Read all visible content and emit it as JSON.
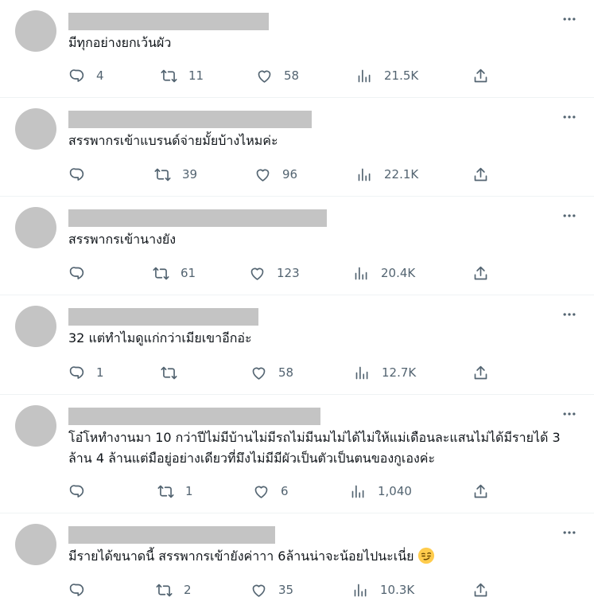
{
  "tweets": [
    {
      "text": "มีทุกอย่างยกเว้นผัว",
      "replies": "4",
      "retweets": "11",
      "likes": "58",
      "views": "21.5K"
    },
    {
      "text": "สรรพากรเข้าแบรนด์จ่ายมั้ยบ้างไหมค่ะ",
      "replies": "",
      "retweets": "39",
      "likes": "96",
      "views": "22.1K"
    },
    {
      "text": "สรรพากรเข้านางยัง",
      "replies": "",
      "retweets": "61",
      "likes": "123",
      "views": "20.4K"
    },
    {
      "text": "32 แต่ทำไมดูแก่กว่าเมียเขาอีกอ่ะ",
      "replies": "1",
      "retweets": "",
      "likes": "58",
      "views": "12.7K"
    },
    {
      "text": "โอ๋โหทำงานมา 10 กว่าปีไม่มีบ้านไม่มีรถไม่มีนมไม่ได้ไม่ให้แม่เดือนละแสนไม่ได้มีรายได้ 3 ล้าน 4 ล้านแต่มือยู่อย่างเดียวที่มึงไม่มีมีผัวเป็นตัวเป็นตนของกูเองค่ะ",
      "replies": "",
      "retweets": "1",
      "likes": "6",
      "views": "1,040"
    },
    {
      "text": "มีรายได้ขนาดนี้ สรรพากรเข้ายังค่าาา 6ล้านน่าจะน้อยไปนะเนี่ย",
      "emoji": "smirking-face",
      "replies": "",
      "retweets": "2",
      "likes": "35",
      "views": "10.3K"
    }
  ],
  "icons": {
    "reply": "reply-icon",
    "retweet": "retweet-icon",
    "like": "heart-icon",
    "views": "views-icon",
    "share": "share-icon",
    "more": "more-icon"
  },
  "colors": {
    "icon": "#536471",
    "text": "#0f1419",
    "placeholder": "#c4c4c4",
    "divider": "#eff3f4"
  }
}
